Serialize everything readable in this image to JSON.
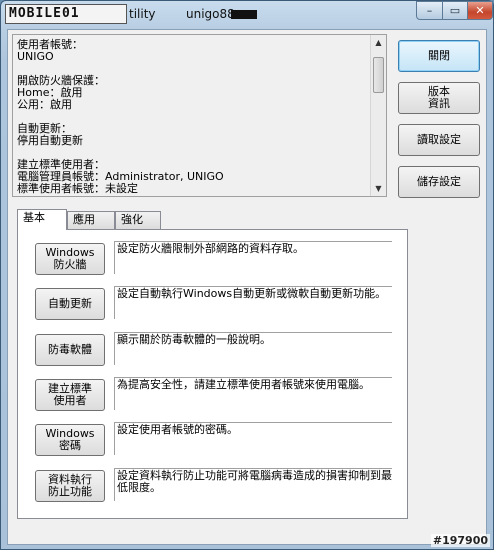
{
  "titlebar": {
    "logo_text": "MOBILE01",
    "title": "tility",
    "user": "unigo88",
    "min_glyph": "–",
    "max_glyph": "▭",
    "close_glyph": "✕"
  },
  "info": {
    "lines": [
      "使用者帳號：",
      "    UNIGO",
      "",
      "開啟防火牆保護：",
      "    Home：啟用",
      "    公用：啟用",
      "",
      "自動更新：",
      "    停用自動更新",
      "",
      "建立標準使用者：",
      "    電腦管理員帳號：Administrator, UNIGO",
      "    標準使用者帳號：未設定"
    ]
  },
  "side_buttons": {
    "close": "關閉",
    "version_l1": "版本",
    "version_l2": "資訊",
    "load": "讀取設定",
    "save": "儲存設定"
  },
  "tabs": [
    "基本",
    "應用",
    "強化"
  ],
  "rows": [
    {
      "btn_l1": "Windows",
      "btn_l2": "防火牆",
      "desc": "設定防火牆限制外部網路的資料存取。"
    },
    {
      "btn_l1": "自動更新",
      "btn_l2": "",
      "desc": "設定自動執行Windows自動更新或微軟自動更新功能。"
    },
    {
      "btn_l1": "防毒軟體",
      "btn_l2": "",
      "desc": "顯示關於防毒軟體的一般說明。"
    },
    {
      "btn_l1": "建立標準",
      "btn_l2": "使用者",
      "desc": "為提高安全性，請建立標準使用者帳號來使用電腦。"
    },
    {
      "btn_l1": "Windows",
      "btn_l2": "密碼",
      "desc": "設定使用者帳號的密碼。"
    },
    {
      "btn_l1": "資料執行",
      "btn_l2": "防止功能",
      "desc": "設定資料執行防止功能可將電腦病毒造成的損害抑制到最低限度。"
    }
  ],
  "watermark": "#197900"
}
